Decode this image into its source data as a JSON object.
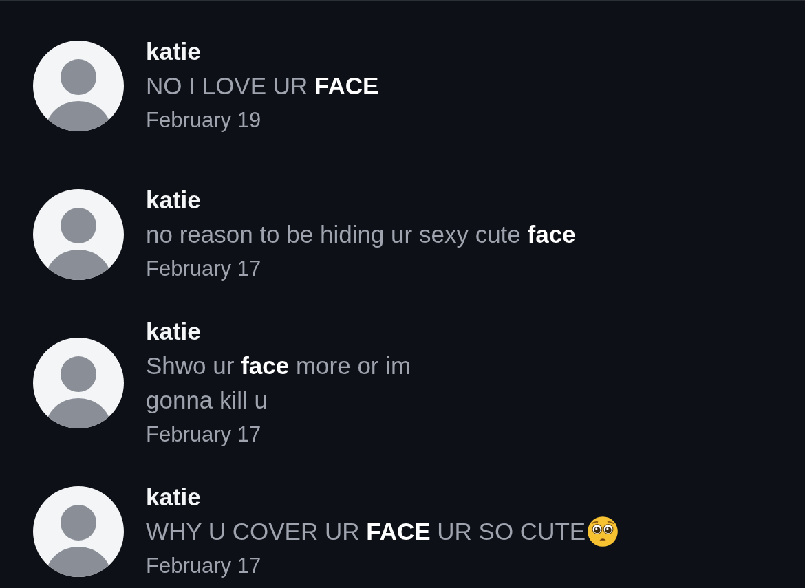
{
  "messages": [
    {
      "sender": "katie",
      "lines": [
        "NO I LOVE UR **FACE**"
      ],
      "emoji": false,
      "date": "February 19"
    },
    {
      "sender": "katie",
      "lines": [
        "no reason to be hiding ur sexy cute **face**"
      ],
      "emoji": false,
      "date": "February 17"
    },
    {
      "sender": "katie",
      "lines": [
        "Shwo ur **face** more or im",
        "gonna kill u"
      ],
      "emoji": false,
      "date": "February 17"
    },
    {
      "sender": "katie",
      "lines": [
        "WHY U COVER UR **FACE** UR SO CUTE"
      ],
      "emoji": true,
      "date": "February 17"
    }
  ]
}
